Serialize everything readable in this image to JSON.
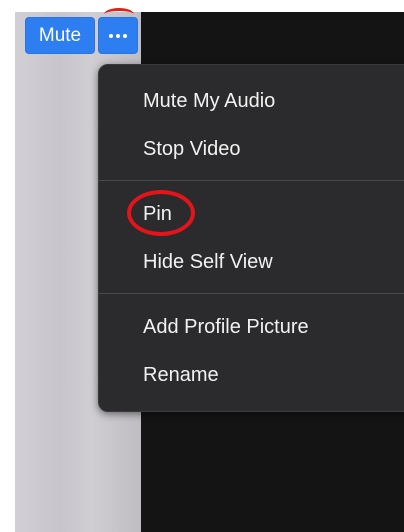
{
  "toolbar": {
    "mute_label": "Mute",
    "more_icon": "more-horizontal-icon"
  },
  "menu": {
    "items": [
      {
        "label": "Mute My Audio"
      },
      {
        "label": "Stop Video"
      },
      {
        "label": "Pin"
      },
      {
        "label": "Hide Self View"
      },
      {
        "label": "Add Profile Picture"
      },
      {
        "label": "Rename"
      }
    ]
  },
  "colors": {
    "button_blue": "#2d7ef0",
    "menu_bg": "#2b2b2d",
    "annotation_red": "#e3141a"
  }
}
